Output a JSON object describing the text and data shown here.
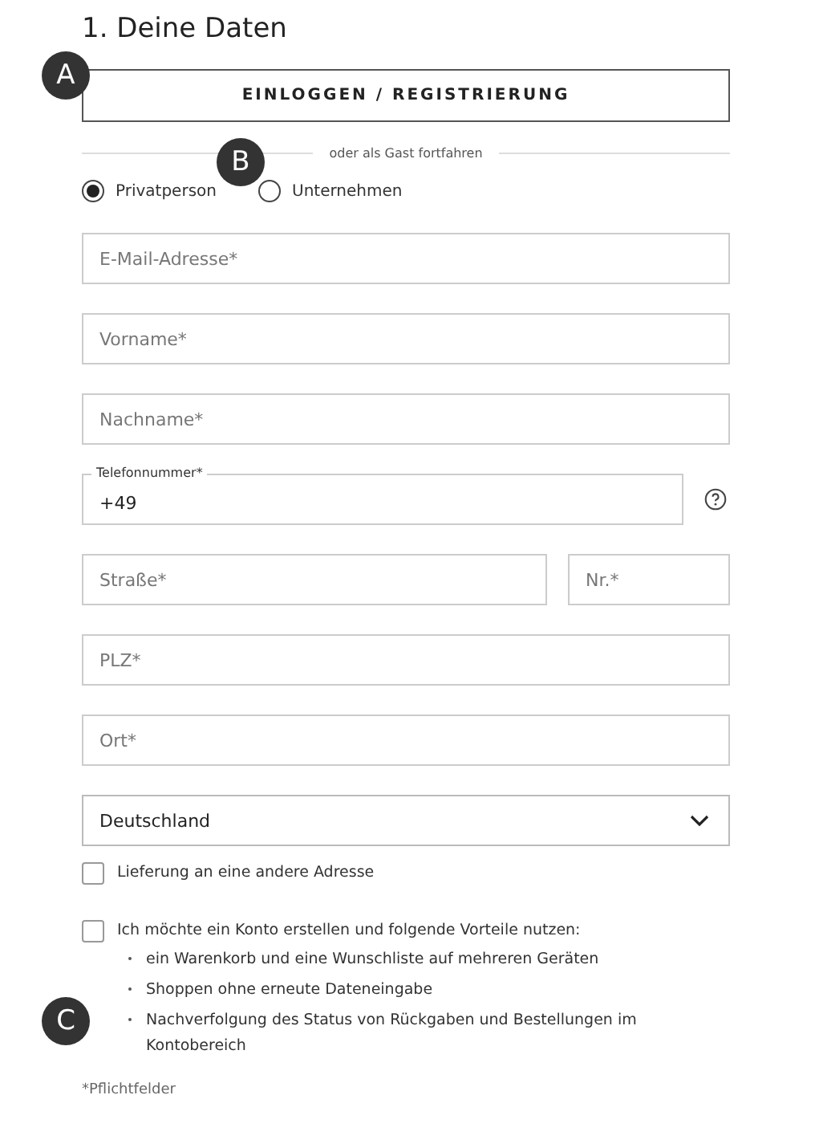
{
  "title": "1. Deine Daten",
  "login_button": "EINLOGGEN / REGISTRIERUNG",
  "divider_text": "oder als Gast fortfahren",
  "customer_type": [
    {
      "label": "Privatperson",
      "selected": true
    },
    {
      "label": "Unternehmen",
      "selected": false
    }
  ],
  "fields": [
    [
      {
        "kind": "text",
        "placeholder": "E-Mail-Adresse*"
      }
    ],
    [
      {
        "kind": "text",
        "placeholder": "Vorname*"
      }
    ],
    [
      {
        "kind": "text",
        "placeholder": "Nachname*"
      }
    ],
    [
      {
        "kind": "phone",
        "label": "Telefonnummer*",
        "value": "+49"
      }
    ],
    [
      {
        "kind": "text",
        "placeholder": "Straße*"
      },
      {
        "kind": "short",
        "placeholder": "Nr.*"
      }
    ],
    [
      {
        "kind": "text",
        "placeholder": "PLZ*"
      }
    ],
    [
      {
        "kind": "text",
        "placeholder": "Ort*"
      }
    ],
    [
      {
        "kind": "select",
        "value": "Deutschland"
      }
    ]
  ],
  "checkboxes": [
    {
      "label": "Lieferung an eine andere Adresse",
      "checked": false
    },
    {
      "label": "Ich möchte ein Konto erstellen und folgende Vorteile nutzen:",
      "checked": false,
      "benefits": [
        "ein Warenkorb und eine Wunschliste auf mehreren Geräten",
        "Shoppen ohne erneute Dateneingabe",
        "Nachverfolgung des Status von Rückgaben und Bestellungen im Kontobereich"
      ]
    }
  ],
  "footnote": "*Pflichtfelder",
  "markers": [
    "A",
    "B",
    "C"
  ]
}
